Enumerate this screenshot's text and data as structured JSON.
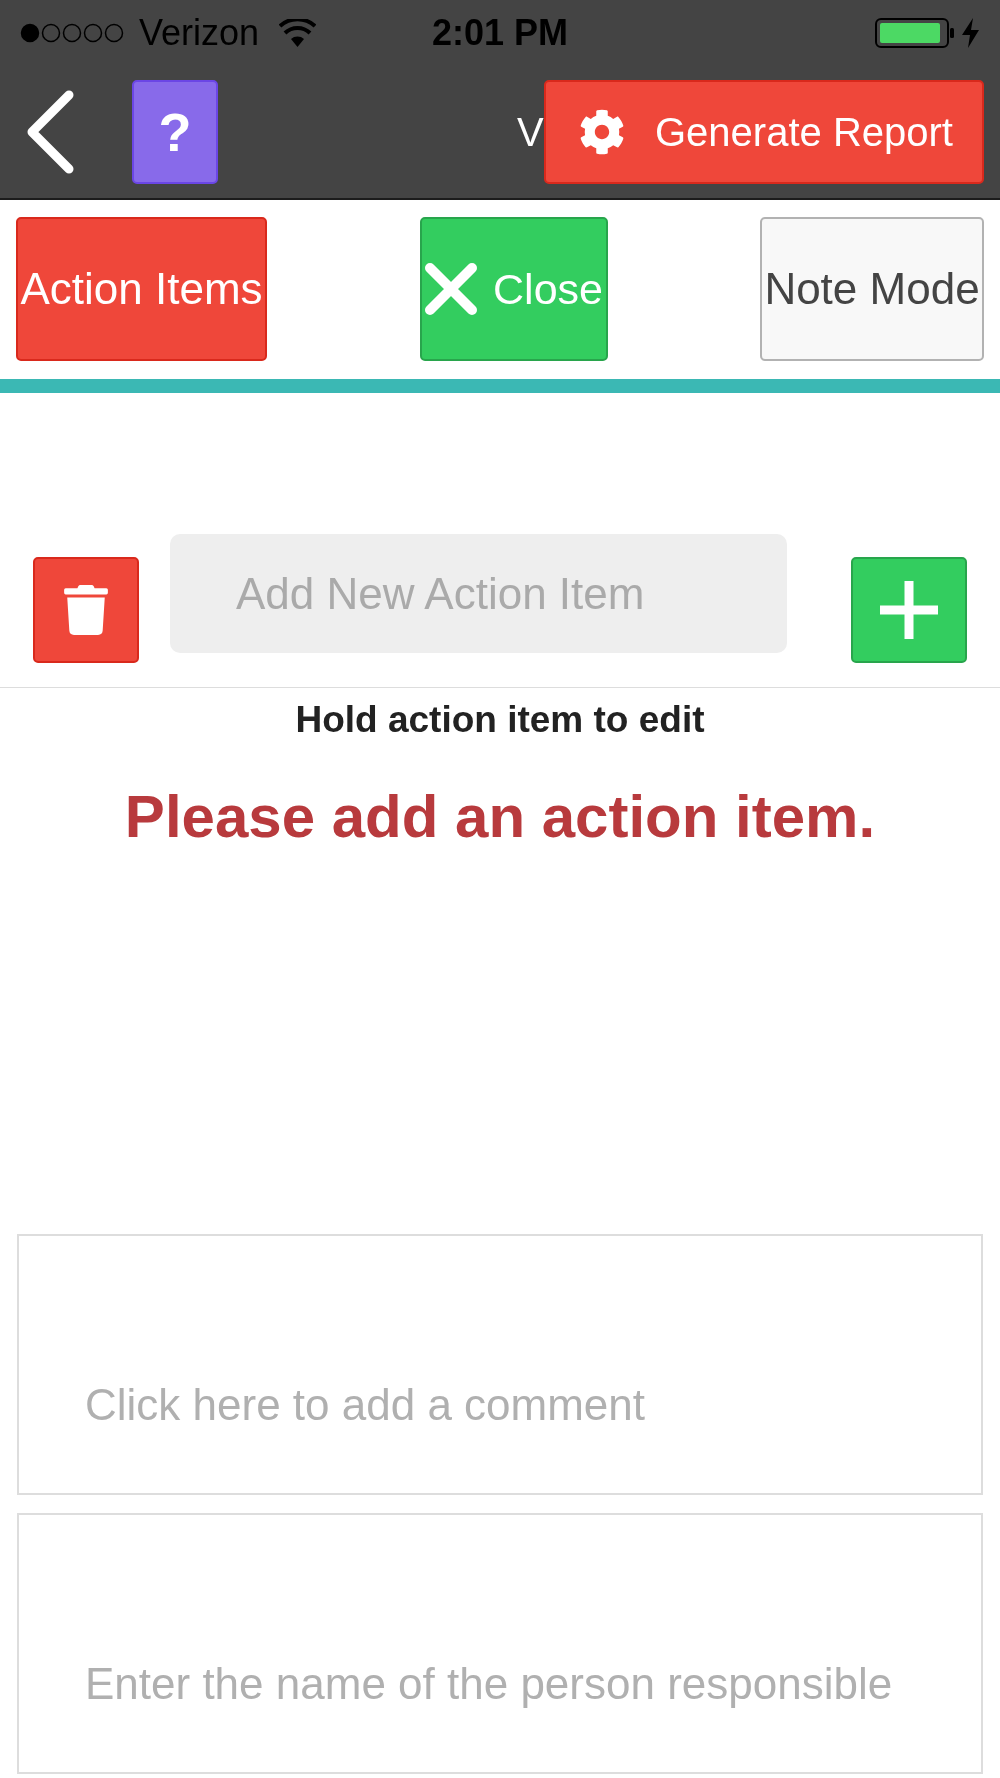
{
  "status_bar": {
    "carrier": "Verizon",
    "time": "2:01 PM"
  },
  "header": {
    "title": "V",
    "help_button": {
      "label": "?"
    },
    "report_button": {
      "label": "Generate Report"
    }
  },
  "mode_tabs": [
    {
      "label": "Action Items",
      "selected": true
    },
    {
      "label": "Note Mode",
      "selected": false
    }
  ],
  "close_button": {
    "label": "Close"
  },
  "action_item_input": {
    "placeholder": "Add New Action Item"
  },
  "hint": "Hold action item to edit",
  "empty_message": "Please add an action item.",
  "comment_field": {
    "placeholder": "Click here to add a comment"
  },
  "responsible_field": {
    "placeholder": "Enter the name of the person responsible"
  }
}
